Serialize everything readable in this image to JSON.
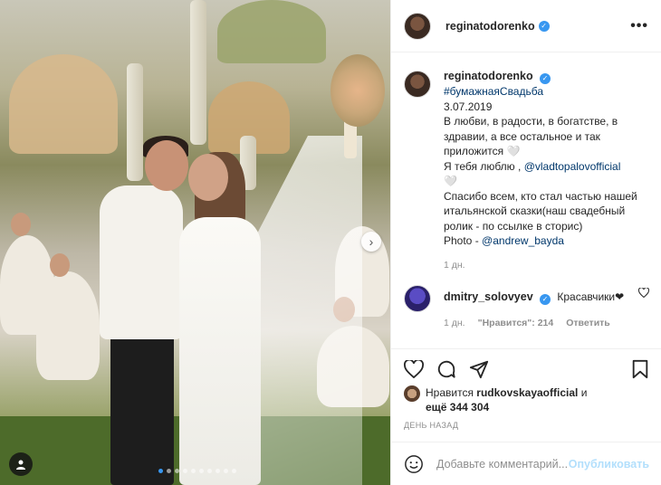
{
  "post": {
    "username": "reginatodorenko",
    "more_label": "•••"
  },
  "caption": {
    "username": "reginatodorenko",
    "hashtag": "#бумажнаяСвадьба",
    "date_line": "3.07.2019",
    "line1": "В любви, в радости, в богатстве, в здравии, а все остальное и так приложится 🤍",
    "line2_prefix": "Я тебя люблю ,",
    "mention": "@vladtopalovofficial",
    "line2_suffix": "🤍",
    "line3": "Спасибо всем, кто стал частью нашей итальянской сказки(наш свадебный ролик - по ссылке в сторис)",
    "photo_prefix": "Photo -",
    "photo_mention": "@andrew_bayda",
    "time": "1 дн."
  },
  "comment": {
    "username": "dmitry_solovyev",
    "text": "Красавчики❤",
    "time": "1 дн.",
    "likes": "\"Нравится\": 214",
    "reply": "Ответить"
  },
  "likes": {
    "prefix": "Нравится",
    "user": "rudkovskayaofficial",
    "middle": "и",
    "others": "ещё 344 304"
  },
  "date": "ДЕНЬ НАЗАД",
  "add_comment": {
    "placeholder": "Добавьте комментарий...",
    "publish": "Опубликовать"
  },
  "colors": {
    "accent": "#3897f0",
    "link": "#00376b",
    "muted": "#8e8e8e"
  }
}
